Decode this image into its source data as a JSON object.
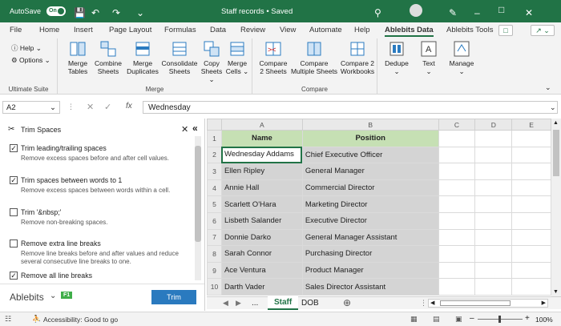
{
  "titlebar": {
    "autosave": "AutoSave",
    "autosave_state": "On",
    "doc_title": "Staff records • Saved",
    "brand_color": "#217346"
  },
  "menu": {
    "tabs": [
      "File",
      "Home",
      "Insert",
      "Page Layout",
      "Formulas",
      "Data",
      "Review",
      "View",
      "Automate",
      "Help",
      "Ablebits Data",
      "Ablebits Tools"
    ],
    "active": "Ablebits Data"
  },
  "ribbon": {
    "ultimate": {
      "help": "Help",
      "options": "Options",
      "label": "Ultimate Suite"
    },
    "merge": {
      "label": "Merge",
      "buttons": [
        {
          "l1": "Merge",
          "l2": "Tables"
        },
        {
          "l1": "Combine",
          "l2": "Sheets"
        },
        {
          "l1": "Merge",
          "l2": "Duplicates"
        },
        {
          "l1": "Consolidate",
          "l2": "Sheets"
        },
        {
          "l1": "Copy",
          "l2": "Sheets"
        },
        {
          "l1": "Merge",
          "l2": "Cells"
        }
      ]
    },
    "compare": {
      "label": "Compare",
      "buttons": [
        {
          "l1": "Compare",
          "l2": "2 Sheets"
        },
        {
          "l1": "Compare",
          "l2": "Multiple Sheets"
        },
        {
          "l1": "Compare 2",
          "l2": "Workbooks"
        }
      ]
    },
    "dedupe": "Dedupe",
    "text": "Text",
    "manage": "Manage"
  },
  "formula": {
    "cell": "A2",
    "fx": "fx",
    "value": "Wednesday"
  },
  "pane": {
    "title": "Trim Spaces",
    "options": [
      {
        "label": "Trim leading/trailing spaces",
        "desc": "Remove excess spaces before and after cell values.",
        "checked": true
      },
      {
        "label": "Trim spaces between words to 1",
        "desc": "Remove excess spaces between words within a cell.",
        "checked": true
      },
      {
        "label": "Trim '&nbsp;'",
        "desc": "Remove non-breaking spaces.",
        "checked": false
      },
      {
        "label": "Remove extra line breaks",
        "desc": "Remove line breaks before and after values and reduce several consecutive line breaks to one.",
        "checked": false
      },
      {
        "label": "Remove all line breaks",
        "desc": "",
        "checked": true
      }
    ],
    "brand": "Ablebits",
    "f1": "F1",
    "trim_button": "Trim"
  },
  "sheet": {
    "columns": [
      "A",
      "B",
      "C",
      "D",
      "E"
    ],
    "rows": [
      {
        "n": "1",
        "a": "Name",
        "b": "Position"
      },
      {
        "n": "2",
        "a": "Wednesday Addams",
        "b": "Chief  Executive  Officer"
      },
      {
        "n": "3",
        "a": "Ellen Ripley",
        "b": "General   Manager"
      },
      {
        "n": "4",
        "a": "Annie Hall",
        "b": "Commercial    Director"
      },
      {
        "n": "5",
        "a": "Scarlett O'Hara",
        "b": "Marketing   Director"
      },
      {
        "n": "6",
        "a": "Lisbeth Salander",
        "b": "Executive Director"
      },
      {
        "n": "7",
        "a": "Donnie Darko",
        "b": "General    Manager      Assistant"
      },
      {
        "n": "8",
        "a": "Sarah Connor",
        "b": "Purchasing       Director"
      },
      {
        "n": "9",
        "a": "Ace Ventura",
        "b": "Product    Manager"
      },
      {
        "n": "10",
        "a": "Darth Vader",
        "b": "Sales   Director   Assistant"
      }
    ],
    "tabs": [
      "...",
      "Staff",
      "DOB"
    ],
    "active_tab": "Staff"
  },
  "status": {
    "accessibility": "Accessibility: Good to go",
    "zoom": "100%"
  }
}
